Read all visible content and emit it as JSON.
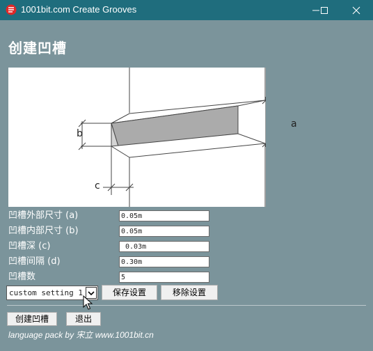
{
  "window": {
    "title": "1001bit.com Create Grooves",
    "icon": "app-logo-icon",
    "controls": [
      "minimize-icon",
      "maximize-icon",
      "close-icon"
    ],
    "titlebar_color": "#1f6d7d",
    "background_color": "#7b949b"
  },
  "heading": "创建凹槽",
  "diagram": {
    "labels": {
      "a": "a",
      "b": "b",
      "c": "c"
    }
  },
  "fields": [
    {
      "label": "凹槽外部尺寸 (a)",
      "value": "0.05m"
    },
    {
      "label": "凹槽内部尺寸 (b)",
      "value": "0.05m"
    },
    {
      "label": "凹槽深 (c)",
      "value": " 0.03m"
    },
    {
      "label": "凹槽间隔 (d)",
      "value": "0.30m"
    },
    {
      "label": "凹槽数",
      "value": "5"
    }
  ],
  "preset": {
    "selected": "custom setting 1"
  },
  "buttons": {
    "save": "保存设置",
    "remove": "移除设置",
    "create": "创建凹槽",
    "exit": "退出"
  },
  "credit": "language pack by 宋立 www.1001bit.cn"
}
